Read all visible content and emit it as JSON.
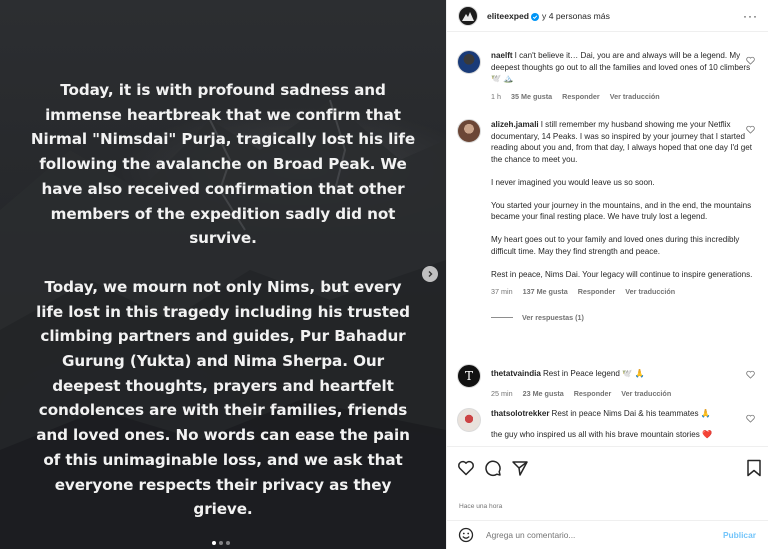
{
  "post": {
    "text_paragraphs": [
      "Today, it is with profound sadness and immense heartbreak that we confirm that Nirmal \"Nimsdai\" Purja, tragically lost his life following the avalanche on Broad Peak. We have also received confirmation that other members of the expedition sadly did not survive.",
      "Today, we mourn not only Nims, but every life lost in this tragedy including his trusted climbing partners and guides, Pur Bahadur Gurung (Yukta) and Nima Sherpa. Our deepest thoughts, prayers and heartfelt condolences are with their families, friends and loved ones. No words can ease the pain of this unimaginable loss, and we ask that everyone respects their privacy as they grieve."
    ],
    "carousel_position": "1 of 3"
  },
  "header": {
    "owner": "eliteexped",
    "others": "y 4 personas más",
    "more": "···"
  },
  "comments": [
    {
      "user": "naelft",
      "paragraphs": [
        "I can't believe it… Dai, you are and always will be a legend. My deepest thoughts go out to all the families and loved ones of 10 climbers 🕊️ 🏔️"
      ],
      "time": "1 h",
      "likes": "35 Me gusta",
      "reply": "Responder",
      "translate": "Ver traducción"
    },
    {
      "user": "alizeh.jamali",
      "paragraphs": [
        "I still remember my husband showing me your Netflix documentary, 14 Peaks. I was so inspired by your journey that I started reading about you and, from that day, I always hoped that one day I'd get the chance to meet you.",
        "I never imagined you would leave us so soon.",
        "You started your journey in the mountains, and in the end, the mountains became your final resting place. We have truly lost a legend.",
        "My heart goes out to your family and loved ones during this incredibly difficult time. May they find strength and peace.",
        "Rest in peace, Nims Dai. Your legacy will continue to inspire generations."
      ],
      "time": "37 min",
      "likes": "137 Me gusta",
      "reply": "Responder",
      "translate": "Ver traducción",
      "replies": "Ver respuestas (1)"
    },
    {
      "user": "thetatvaindia",
      "avatar_letter": "T",
      "paragraphs": [
        "Rest in Peace legend 🕊️ 🙏"
      ],
      "time": "25 min",
      "likes": "23 Me gusta",
      "reply": "Responder",
      "translate": "Ver traducción"
    },
    {
      "user": "thatsolotrekker",
      "paragraphs": [
        "Rest in peace Nims Dai & his teammates 🙏",
        "the guy who inspired us all with his brave mountain stories ❤️"
      ]
    }
  ],
  "footer": {
    "time_ago": "Hace una hora",
    "comment_placeholder": "Agrega un comentario...",
    "publish": "Publicar"
  },
  "colors": {
    "accent": "#0095f6",
    "like_red": "#ed4956",
    "muted_text": "#737373"
  }
}
